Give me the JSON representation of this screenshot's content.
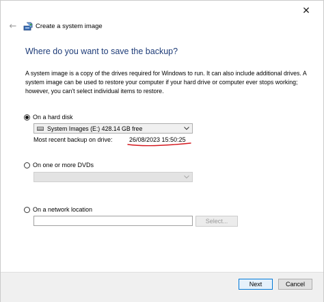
{
  "window": {
    "title": "Create a system image",
    "close_glyph": "✕",
    "back_glyph": "←"
  },
  "heading": "Where do you want to save the backup?",
  "description": "A system image is a copy of the drives required for Windows to run. It can also include additional drives. A system image can be used to restore your computer if your hard drive or computer ever stops working; however, you can't select individual items to restore.",
  "options": {
    "hard_disk": {
      "label": "On a hard disk",
      "selected": true,
      "drive_value": "System Images (E:)  428.14 GB free",
      "recent_label": "Most recent backup on drive:",
      "recent_value": "26/08/2023 15:50:25",
      "annotation_color": "#d4161c"
    },
    "dvds": {
      "label": "On one or more DVDs",
      "selected": false,
      "value": ""
    },
    "network": {
      "label": "On a network location",
      "selected": false,
      "input_value": "",
      "select_button": "Select..."
    }
  },
  "buttons": {
    "next": "Next",
    "cancel": "Cancel"
  },
  "colors": {
    "heading": "#1e3c78",
    "primary_border": "#0078d7",
    "footer_bg": "#f0f0f0"
  },
  "icons": {
    "app": "system-image-backup-icon",
    "drive": "hard-drive-icon",
    "back": "back-arrow-icon",
    "close": "close-icon",
    "dropdown": "chevron-down-icon"
  }
}
